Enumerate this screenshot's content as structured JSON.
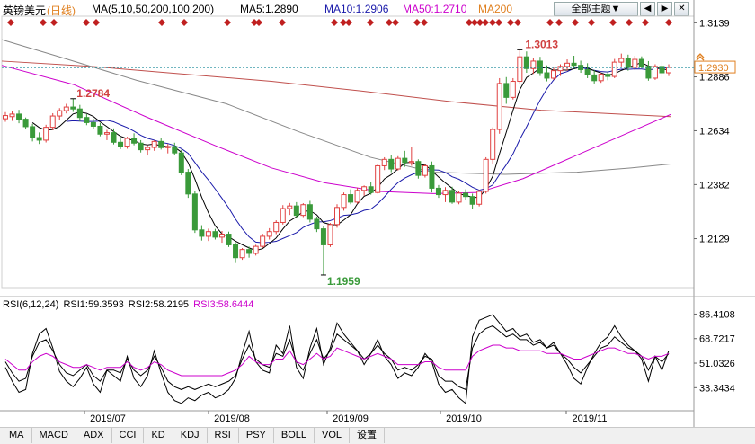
{
  "header": {
    "symbol": "英镑美元",
    "period": "(日线)",
    "ma_params": "MA(5,10,50,200,100,200)",
    "ma5": "MA5:1.2890",
    "ma10": "MA10:1.2906",
    "ma50": "MA50:1.2710",
    "ma200": "MA200",
    "theme_button": "全部主题▼",
    "button_left": "◀",
    "button_right": "▶",
    "button_close": "✕"
  },
  "rsi_header": {
    "params": "RSI(6,12,24)",
    "rsi1": "RSI1:59.3593",
    "rsi2": "RSI2:58.2195",
    "rsi3": "RSI3:58.6444"
  },
  "colors": {
    "up": "#e04040",
    "down": "#3a9a3a",
    "ma5": "#000000",
    "ma10": "#1a1aaa",
    "ma50": "#cc00cc",
    "ma100": "#888888",
    "ma200": "#c0504d",
    "price_line": "#1a8a9a",
    "price_tag": "#e08020",
    "marker": "#c02020",
    "rsi1": "#000000",
    "rsi2": "#000000",
    "rsi3": "#cc00cc"
  },
  "price_label": "1.2930",
  "price_arrow_icon": "double-up-arrow-icon",
  "chart_data": [
    {
      "type": "candlestick",
      "title": "英镑美元 (日线)",
      "yticks": [
        "1.3139",
        "1.2886",
        "1.2634",
        "1.2382",
        "1.2129"
      ],
      "ylim": [
        1.19,
        1.317
      ],
      "xticks": [
        "2019/07",
        "2019/08",
        "2019/09",
        "2019/10",
        "2019/11"
      ],
      "annotations": [
        {
          "text": "1.3013",
          "value": 1.3013,
          "kind": "high"
        },
        {
          "text": "1.2784",
          "value": 1.2784,
          "kind": "local-high"
        },
        {
          "text": "1.1959",
          "value": 1.1959,
          "kind": "low"
        }
      ],
      "current_price": 1.293,
      "ohlc": [
        [
          1.269,
          1.2721,
          1.2676,
          1.2705
        ],
        [
          1.27,
          1.2725,
          1.268,
          1.2712
        ],
        [
          1.2712,
          1.2732,
          1.2669,
          1.2688
        ],
        [
          1.2688,
          1.2696,
          1.264,
          1.2653
        ],
        [
          1.2653,
          1.2666,
          1.2584,
          1.2602
        ],
        [
          1.2602,
          1.2626,
          1.2572,
          1.259
        ],
        [
          1.259,
          1.2662,
          1.2579,
          1.265
        ],
        [
          1.265,
          1.2716,
          1.2636,
          1.2703
        ],
        [
          1.2703,
          1.274,
          1.2685,
          1.2728
        ],
        [
          1.2728,
          1.276,
          1.2715,
          1.2745
        ],
        [
          1.2745,
          1.2784,
          1.2722,
          1.2736
        ],
        [
          1.2736,
          1.2755,
          1.2678,
          1.2696
        ],
        [
          1.2696,
          1.2712,
          1.266,
          1.2672
        ],
        [
          1.2672,
          1.269,
          1.264,
          1.2655
        ],
        [
          1.2655,
          1.267,
          1.2608,
          1.2618
        ],
        [
          1.2618,
          1.2638,
          1.259,
          1.2625
        ],
        [
          1.2625,
          1.2645,
          1.257,
          1.258
        ],
        [
          1.258,
          1.26,
          1.2548,
          1.2562
        ],
        [
          1.2562,
          1.2606,
          1.255,
          1.2598
        ],
        [
          1.2598,
          1.2622,
          1.2566,
          1.2576
        ],
        [
          1.2576,
          1.259,
          1.2532,
          1.2545
        ],
        [
          1.2545,
          1.2566,
          1.2518,
          1.2556
        ],
        [
          1.2556,
          1.259,
          1.254,
          1.2584
        ],
        [
          1.2584,
          1.26,
          1.2546,
          1.2555
        ],
        [
          1.2555,
          1.2572,
          1.2528,
          1.256
        ],
        [
          1.256,
          1.2578,
          1.252,
          1.253
        ],
        [
          1.253,
          1.2545,
          1.2426,
          1.244
        ],
        [
          1.244,
          1.2455,
          1.232,
          1.2338
        ],
        [
          1.2338,
          1.235,
          1.2156,
          1.217
        ],
        [
          1.217,
          1.2192,
          1.212,
          1.214
        ],
        [
          1.214,
          1.2176,
          1.2118,
          1.2162
        ],
        [
          1.2162,
          1.2175,
          1.2125,
          1.2136
        ],
        [
          1.2136,
          1.2165,
          1.211,
          1.215
        ],
        [
          1.215,
          1.2162,
          1.209,
          1.21
        ],
        [
          1.21,
          1.2112,
          1.2015,
          1.204
        ],
        [
          1.204,
          1.2085,
          1.203,
          1.2078
        ],
        [
          1.2078,
          1.2092,
          1.204,
          1.206
        ],
        [
          1.206,
          1.21,
          1.205,
          1.2093
        ],
        [
          1.2093,
          1.2152,
          1.2085,
          1.214
        ],
        [
          1.214,
          1.2178,
          1.2125,
          1.2162
        ],
        [
          1.2162,
          1.2215,
          1.215,
          1.2205
        ],
        [
          1.2205,
          1.2286,
          1.2195,
          1.227
        ],
        [
          1.227,
          1.2296,
          1.224,
          1.2282
        ],
        [
          1.2282,
          1.23,
          1.2225,
          1.2238
        ],
        [
          1.2238,
          1.2295,
          1.223,
          1.2288
        ],
        [
          1.2288,
          1.2306,
          1.2205,
          1.222
        ],
        [
          1.222,
          1.2232,
          1.216,
          1.2175
        ],
        [
          1.2175,
          1.2188,
          1.1959,
          1.21
        ],
        [
          1.21,
          1.2202,
          1.209,
          1.2195
        ],
        [
          1.2195,
          1.229,
          1.218,
          1.2275
        ],
        [
          1.2275,
          1.2345,
          1.226,
          1.2335
        ],
        [
          1.2335,
          1.236,
          1.229,
          1.23
        ],
        [
          1.23,
          1.2368,
          1.2292,
          1.2355
        ],
        [
          1.2355,
          1.2378,
          1.233,
          1.2372
        ],
        [
          1.2372,
          1.2395,
          1.2335,
          1.2345
        ],
        [
          1.2345,
          1.248,
          1.234,
          1.247
        ],
        [
          1.247,
          1.251,
          1.245,
          1.25
        ],
        [
          1.25,
          1.252,
          1.244,
          1.2455
        ],
        [
          1.2455,
          1.2515,
          1.2448,
          1.2505
        ],
        [
          1.2505,
          1.254,
          1.2465,
          1.2485
        ],
        [
          1.2485,
          1.256,
          1.247,
          1.249
        ],
        [
          1.249,
          1.25,
          1.241,
          1.2425
        ],
        [
          1.2425,
          1.248,
          1.2415,
          1.247
        ],
        [
          1.247,
          1.249,
          1.2345,
          1.2365
        ],
        [
          1.2365,
          1.238,
          1.232,
          1.2335
        ],
        [
          1.2335,
          1.237,
          1.23,
          1.2355
        ],
        [
          1.2355,
          1.2372,
          1.2292,
          1.23
        ],
        [
          1.23,
          1.235,
          1.229,
          1.2342
        ],
        [
          1.2342,
          1.236,
          1.2308,
          1.2326
        ],
        [
          1.2326,
          1.234,
          1.227,
          1.229
        ],
        [
          1.229,
          1.2358,
          1.228,
          1.235
        ],
        [
          1.235,
          1.251,
          1.234,
          1.25
        ],
        [
          1.25,
          1.265,
          1.248,
          1.264
        ],
        [
          1.264,
          1.288,
          1.262,
          1.2855
        ],
        [
          1.2855,
          1.2885,
          1.276,
          1.279
        ],
        [
          1.279,
          1.288,
          1.278,
          1.2865
        ],
        [
          1.2865,
          1.3013,
          1.285,
          1.298
        ],
        [
          1.298,
          1.3005,
          1.2905,
          1.2925
        ],
        [
          1.2925,
          1.2975,
          1.29,
          1.296
        ],
        [
          1.296,
          1.298,
          1.289,
          1.2905
        ],
        [
          1.2905,
          1.294,
          1.2865,
          1.288
        ],
        [
          1.288,
          1.293,
          1.2872,
          1.2915
        ],
        [
          1.2915,
          1.2945,
          1.289,
          1.2935
        ],
        [
          1.2935,
          1.2968,
          1.2915,
          1.295
        ],
        [
          1.295,
          1.2985,
          1.2925,
          1.294
        ],
        [
          1.294,
          1.2962,
          1.2905,
          1.292
        ],
        [
          1.292,
          1.295,
          1.288,
          1.2895
        ],
        [
          1.2895,
          1.2918,
          1.2855,
          1.2868
        ],
        [
          1.2868,
          1.2905,
          1.2858,
          1.2898
        ],
        [
          1.2898,
          1.2912,
          1.287,
          1.2888
        ],
        [
          1.2888,
          1.297,
          1.288,
          1.2955
        ],
        [
          1.2955,
          1.2995,
          1.2935,
          1.2972
        ],
        [
          1.2972,
          1.299,
          1.2915,
          1.293
        ],
        [
          1.293,
          1.2985,
          1.2918,
          1.2968
        ],
        [
          1.2968,
          1.2982,
          1.2925,
          1.2935
        ],
        [
          1.2935,
          1.296,
          1.2868,
          1.288
        ],
        [
          1.288,
          1.2945,
          1.2872,
          1.2935
        ],
        [
          1.2935,
          1.2958,
          1.2885,
          1.2905
        ],
        [
          1.2905,
          1.2945,
          1.289,
          1.293
        ]
      ],
      "ma100": [
        [
          0,
          1.306
        ],
        [
          60,
          1.2985
        ],
        [
          150,
          1.287
        ],
        [
          250,
          1.276
        ],
        [
          330,
          1.263
        ],
        [
          410,
          1.251
        ],
        [
          480,
          1.244
        ],
        [
          560,
          1.243
        ],
        [
          640,
          1.244
        ],
        [
          700,
          1.246
        ],
        [
          744,
          1.2478
        ]
      ],
      "ma200": [
        [
          0,
          1.296
        ],
        [
          100,
          1.2935
        ],
        [
          200,
          1.29
        ],
        [
          300,
          1.2865
        ],
        [
          400,
          1.282
        ],
        [
          500,
          1.277
        ],
        [
          600,
          1.273
        ],
        [
          744,
          1.27
        ]
      ],
      "ma50_visible": [
        [
          0,
          1.294
        ],
        [
          80,
          1.285
        ],
        [
          160,
          1.27
        ],
        [
          240,
          1.256
        ],
        [
          300,
          1.246
        ],
        [
          360,
          1.239
        ],
        [
          420,
          1.235
        ],
        [
          480,
          1.234
        ],
        [
          530,
          1.2345
        ],
        [
          580,
          1.241
        ],
        [
          640,
          1.252
        ],
        [
          700,
          1.263
        ],
        [
          744,
          1.271
        ]
      ]
    },
    {
      "type": "line",
      "title": "RSI(6,12,24)",
      "yticks": [
        "86.4108",
        "68.7217",
        "51.0326",
        "33.3434"
      ],
      "ylim": [
        18.0,
        88.0
      ],
      "series": [
        {
          "name": "RSI1",
          "values": [
            48,
            38,
            30,
            32,
            58,
            72,
            76,
            62,
            45,
            38,
            34,
            40,
            48,
            36,
            30,
            46,
            42,
            38,
            56,
            40,
            34,
            42,
            60,
            44,
            30,
            24,
            22,
            26,
            24,
            28,
            30,
            26,
            28,
            32,
            40,
            58,
            74,
            52,
            46,
            44,
            64,
            58,
            78,
            48,
            40,
            62,
            76,
            50,
            62,
            80,
            72,
            66,
            60,
            50,
            58,
            68,
            56,
            50,
            40,
            44,
            42,
            48,
            58,
            52,
            36,
            30,
            32,
            26,
            22,
            70,
            82,
            84,
            86,
            80,
            74,
            76,
            70,
            72,
            66,
            68,
            62,
            66,
            58,
            50,
            40,
            36,
            48,
            58,
            66,
            70,
            78,
            70,
            64,
            60,
            54,
            38,
            56,
            46,
            60
          ]
        },
        {
          "name": "RSI2",
          "values": [
            52,
            44,
            38,
            40,
            56,
            66,
            68,
            60,
            50,
            44,
            42,
            46,
            50,
            42,
            38,
            46,
            46,
            44,
            54,
            46,
            42,
            46,
            56,
            48,
            38,
            34,
            32,
            34,
            32,
            34,
            36,
            34,
            36,
            38,
            42,
            54,
            64,
            54,
            50,
            48,
            58,
            56,
            68,
            52,
            46,
            58,
            68,
            54,
            60,
            72,
            68,
            64,
            60,
            54,
            58,
            64,
            58,
            54,
            46,
            48,
            46,
            50,
            56,
            54,
            42,
            38,
            38,
            34,
            32,
            62,
            72,
            76,
            78,
            74,
            70,
            72,
            68,
            68,
            64,
            66,
            62,
            64,
            58,
            54,
            48,
            44,
            50,
            56,
            62,
            64,
            70,
            66,
            62,
            60,
            56,
            46,
            56,
            52,
            58
          ]
        },
        {
          "name": "RSI3",
          "values": [
            54,
            50,
            46,
            46,
            52,
            56,
            58,
            56,
            52,
            50,
            48,
            48,
            50,
            48,
            46,
            48,
            48,
            48,
            52,
            48,
            46,
            48,
            52,
            50,
            46,
            44,
            42,
            42,
            42,
            42,
            42,
            42,
            42,
            44,
            46,
            50,
            56,
            52,
            50,
            50,
            54,
            54,
            60,
            52,
            50,
            54,
            58,
            54,
            56,
            62,
            60,
            58,
            56,
            54,
            56,
            58,
            56,
            54,
            50,
            50,
            50,
            50,
            52,
            52,
            48,
            46,
            46,
            46,
            46,
            56,
            60,
            62,
            64,
            64,
            62,
            62,
            60,
            60,
            60,
            60,
            58,
            58,
            58,
            56,
            54,
            54,
            56,
            58,
            60,
            62,
            62,
            60,
            58,
            58,
            56,
            54,
            56,
            56,
            58
          ]
        }
      ],
      "xticks": [
        "2019/07",
        "2019/08",
        "2019/09",
        "2019/10",
        "2019/11"
      ]
    }
  ],
  "tabs": [
    "MA",
    "MACD",
    "ADX",
    "CCI",
    "KD",
    "KDJ",
    "RSI",
    "PSY",
    "BOLL",
    "VOL",
    "设置"
  ]
}
